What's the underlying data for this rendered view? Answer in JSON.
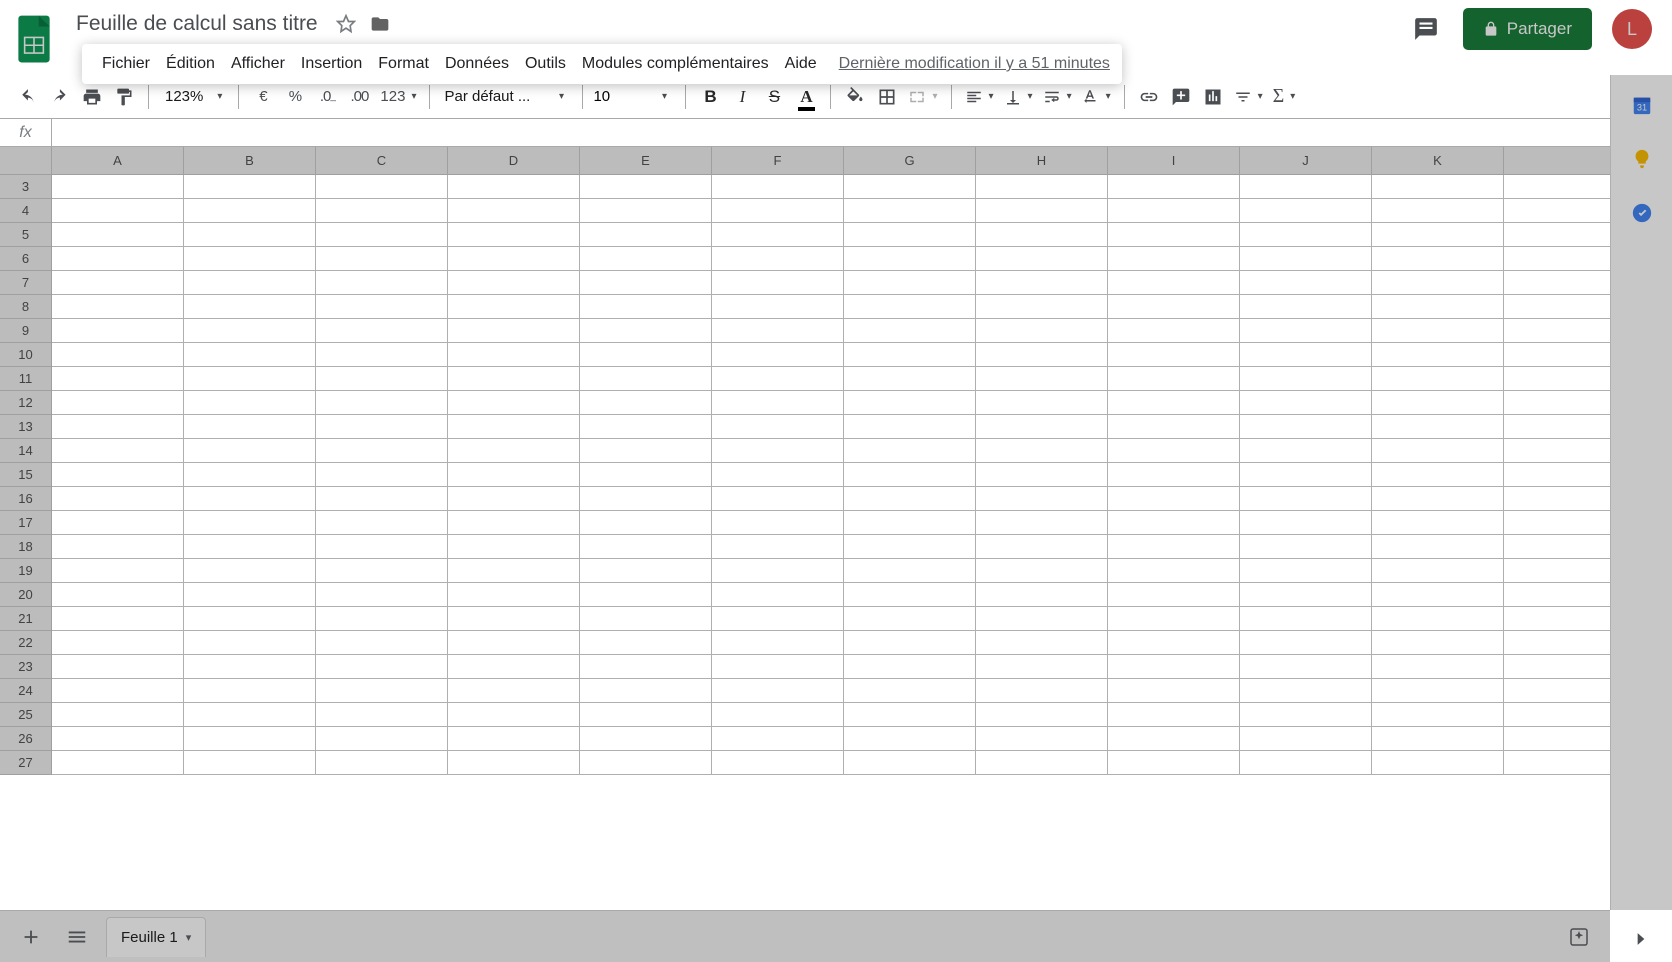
{
  "doc": {
    "title": "Feuille de calcul sans titre"
  },
  "menu": {
    "items": [
      "Fichier",
      "Édition",
      "Afficher",
      "Insertion",
      "Format",
      "Données",
      "Outils",
      "Modules complémentaires",
      "Aide"
    ],
    "last_edit": "Dernière modification il y a 51 minutes"
  },
  "share": {
    "label": "Partager"
  },
  "avatar": {
    "initial": "L",
    "color": "#ef5350"
  },
  "toolbar": {
    "zoom": "123%",
    "currency": "€",
    "percent": "%",
    "dec_dec": ".0",
    "inc_dec": ".00",
    "formats": "123",
    "font": "Par défaut ...",
    "font_size": "10"
  },
  "fx": {
    "label": "fx",
    "value": ""
  },
  "grid": {
    "columns": [
      "A",
      "B",
      "C",
      "D",
      "E",
      "F",
      "G",
      "H",
      "I",
      "J",
      "K",
      ""
    ],
    "first_row": 3,
    "last_row": 27
  },
  "sheet_tabs": {
    "active": "Feuille 1"
  }
}
